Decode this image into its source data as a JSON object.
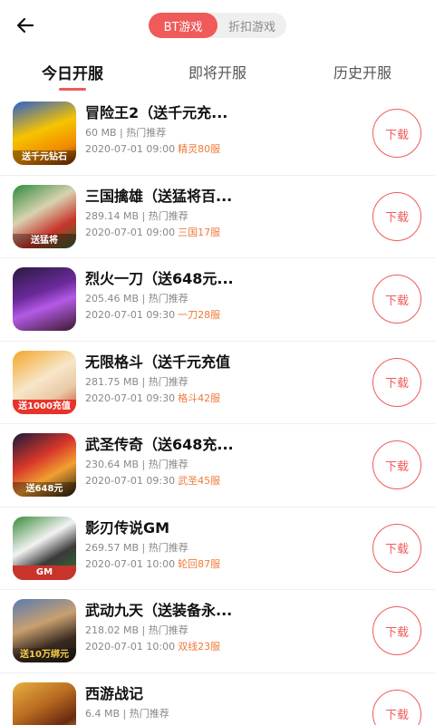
{
  "header": {
    "back_icon": "arrow-left-icon",
    "segments": [
      {
        "label": "BT游戏",
        "active": true
      },
      {
        "label": "折扣游戏",
        "active": false
      }
    ]
  },
  "tabs": [
    {
      "label": "今日开服",
      "active": true
    },
    {
      "label": "即将开服",
      "active": false
    },
    {
      "label": "历史开服",
      "active": false
    }
  ],
  "colors": {
    "accent": "#f05a5a",
    "server_text": "#f07a3a"
  },
  "games": [
    {
      "title": "冒险王2（送千元充...",
      "size": "60 MB",
      "tag": "热门推荐",
      "time": "2020-07-01 09:00",
      "server": "精灵80服",
      "thumb_caption": "送千元钻石",
      "download_label": "下载"
    },
    {
      "title": "三国擒雄（送猛将百...",
      "size": "289.14 MB",
      "tag": "热门推荐",
      "time": "2020-07-01 09:00",
      "server": "三国17服",
      "thumb_caption": "送猛将",
      "download_label": "下载"
    },
    {
      "title": "烈火一刀（送648元...",
      "size": "205.46 MB",
      "tag": "热门推荐",
      "time": "2020-07-01 09:30",
      "server": "一刀28服",
      "thumb_caption": "",
      "download_label": "下载"
    },
    {
      "title": "无限格斗（送千元充值",
      "size": "281.75 MB",
      "tag": "热门推荐",
      "time": "2020-07-01 09:30",
      "server": "格斗42服",
      "thumb_caption": "送1000充值",
      "download_label": "下载"
    },
    {
      "title": "武圣传奇（送648充...",
      "size": "230.64 MB",
      "tag": "热门推荐",
      "time": "2020-07-01 09:30",
      "server": "武圣45服",
      "thumb_caption": "送648元",
      "download_label": "下载"
    },
    {
      "title": "影刃传说GM",
      "size": "269.57 MB",
      "tag": "热门推荐",
      "time": "2020-07-01 10:00",
      "server": "轮回87服",
      "thumb_caption": "GM",
      "download_label": "下载"
    },
    {
      "title": "武动九天（送装备永...",
      "size": "218.02 MB",
      "tag": "热门推荐",
      "time": "2020-07-01 10:00",
      "server": "双线23服",
      "thumb_caption": "送10万绑元",
      "download_label": "下载"
    },
    {
      "title": "西游战记",
      "size": "6.4 MB",
      "tag": "热门推荐",
      "time": "",
      "server": "",
      "thumb_caption": "",
      "download_label": "下载"
    }
  ]
}
